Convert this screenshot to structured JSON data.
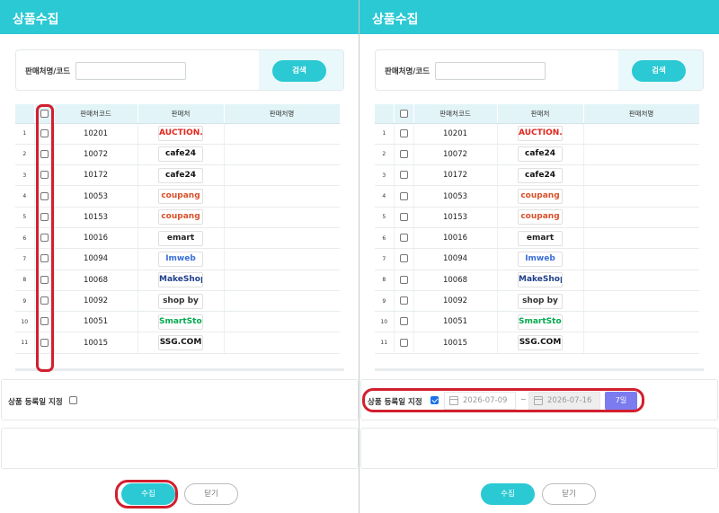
{
  "dialog": {
    "title": "상품수집",
    "search_label": "판매처명/코드",
    "search_value": "",
    "search_button": "검색",
    "columns": [
      "판매처코드",
      "판매처",
      "판매처명"
    ],
    "rows": [
      {
        "num": "1",
        "code": "10201",
        "logo": "AUCTION.",
        "logo_color": "#e1261c"
      },
      {
        "num": "2",
        "code": "10072",
        "logo": "cafe24",
        "logo_color": "#111111"
      },
      {
        "num": "3",
        "code": "10172",
        "logo": "cafe24",
        "logo_color": "#111111"
      },
      {
        "num": "4",
        "code": "10053",
        "logo": "coupang",
        "logo_color": "#d9502a"
      },
      {
        "num": "5",
        "code": "10153",
        "logo": "coupang",
        "logo_color": "#d9502a"
      },
      {
        "num": "6",
        "code": "10016",
        "logo": "emart",
        "logo_color": "#1f1f1f"
      },
      {
        "num": "7",
        "code": "10094",
        "logo": "Imweb",
        "logo_color": "#3a6fd8"
      },
      {
        "num": "8",
        "code": "10068",
        "logo": "MakeShop",
        "logo_color": "#1f3f8a"
      },
      {
        "num": "9",
        "code": "10092",
        "logo": "shop by",
        "logo_color": "#333333"
      },
      {
        "num": "10",
        "code": "10051",
        "logo": "SmartStore",
        "logo_color": "#03a94f"
      },
      {
        "num": "11",
        "code": "10015",
        "logo": "SSG.COM",
        "logo_color": "#111111"
      }
    ],
    "date_label": "상품 등록일 지정",
    "submit_button": "수집",
    "close_button": "닫기"
  },
  "right_panel": {
    "date_from": "2026-07-09",
    "date_sep": "~",
    "date_to": "2026-07-16",
    "days_button": "7일"
  },
  "colors": {
    "accent": "#2ac9d3",
    "highlight": "#d21f2e",
    "days_button": "#7c7cf0"
  }
}
